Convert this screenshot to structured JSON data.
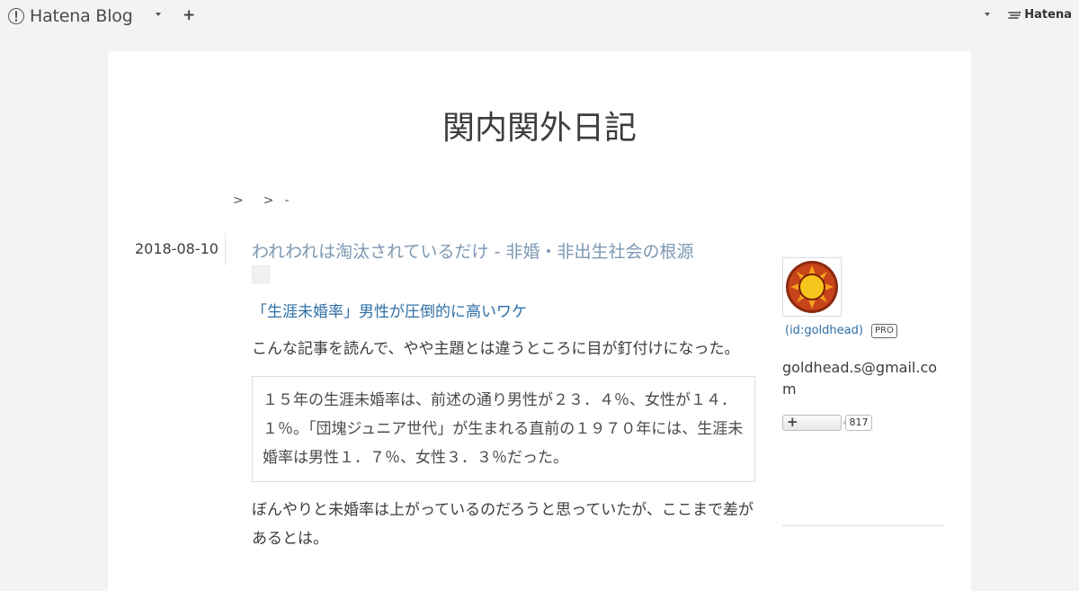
{
  "global_header": {
    "logo_text": "Hatena Blog",
    "plus_label": "+",
    "hatena_label": "Hatena"
  },
  "blog": {
    "title": "関内関外日記",
    "breadcrumb": [
      ">",
      ">",
      "-"
    ]
  },
  "entry": {
    "date": "2018-08-10",
    "title": "われわれは淘汰されているだけ - 非婚・非出生社会の根源",
    "cite_link": "「生涯未婚率」男性が圧倒的に高いワケ",
    "paragraph1": "こんな記事を読んで、やや主題とは違うところに目が釘付けになった。",
    "blockquote": "１５年の生涯未婚率は、前述の通り男性が２３．４％、女性が１４．１％。「団塊ジュニア世代」が生まれる直前の１９７０年には、生涯未婚率は男性１．７％、女性３．３％だった。",
    "paragraph2": "ぼんやりと未婚率は上がっているのだろうと思っていたが、ここまで差があるとは。"
  },
  "sidebar": {
    "user_id": "(id:goldhead)",
    "pro_badge": "PRO",
    "email": "goldhead.s@gmail.com",
    "follow_plus": "+",
    "follow_count": "817"
  },
  "colors": {
    "page_bg": "#f3f3f3",
    "content_bg": "#ffffff",
    "entry_title": "#7d98b3",
    "link": "#2e6fa6",
    "text": "#3d3d3d"
  },
  "icons": {
    "logo": "hatena-blog-logo-icon",
    "avatar": "sun-avatar-icon"
  }
}
